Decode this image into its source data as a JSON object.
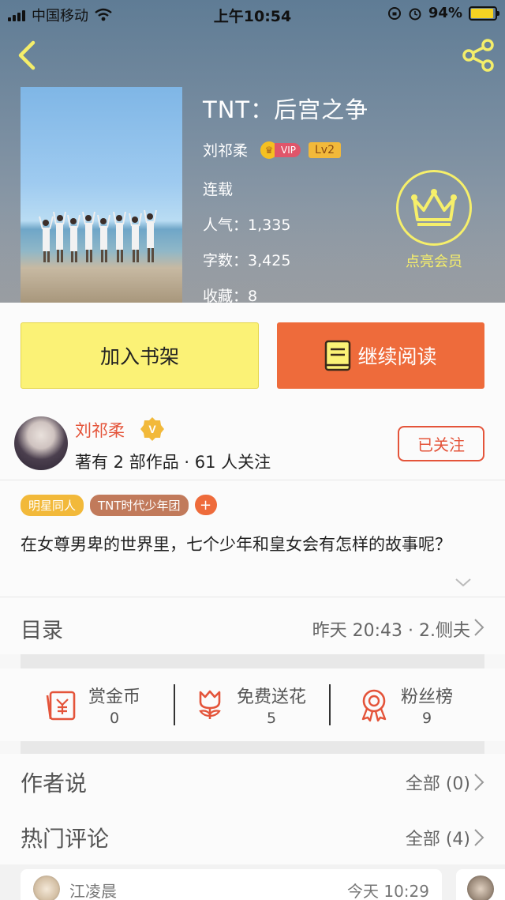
{
  "status_bar": {
    "carrier": "中国移动",
    "time": "上午10:54",
    "battery": "94%",
    "battery_level": 0.94
  },
  "book": {
    "title": "TNT：后宫之争",
    "author": "刘祁柔",
    "vip_label": "VIP",
    "level": "Lv2",
    "status": "连载",
    "popularity_label": "人气：",
    "popularity": "1,335",
    "words_label": "字数：",
    "words": "3,425",
    "favorites_label": "收藏：",
    "favorites": "8"
  },
  "member": {
    "label": "点亮会员"
  },
  "buttons": {
    "add_shelf": "加入书架",
    "continue_read": "继续阅读"
  },
  "author_card": {
    "name": "刘祁柔",
    "meta": "著有 2 部作品 · 61 人关注",
    "follow": "已关注"
  },
  "tags": [
    "明星同人",
    "TNT时代少年团",
    "+"
  ],
  "description": "在女尊男卑的世界里，七个少年和皇女会有怎样的故事呢？",
  "catalog": {
    "label": "目录",
    "meta": "昨天 20:43 · 2.侧夫"
  },
  "actions": [
    {
      "label": "赏金币",
      "count": "0"
    },
    {
      "label": "免费送花",
      "count": "5"
    },
    {
      "label": "粉丝榜",
      "count": "9"
    }
  ],
  "author_says": {
    "title": "作者说",
    "meta": "全部 (0)"
  },
  "hot_comments": {
    "title": "热门评论",
    "meta": "全部 (4)"
  },
  "comment_preview": {
    "name": "江凌晨",
    "time": "今天 10:29"
  },
  "colors": {
    "accent": "#ee6b3b",
    "shelf_yellow": "#fbf276",
    "member_yellow": "#f6ef6a",
    "author_red": "#e4543a"
  }
}
